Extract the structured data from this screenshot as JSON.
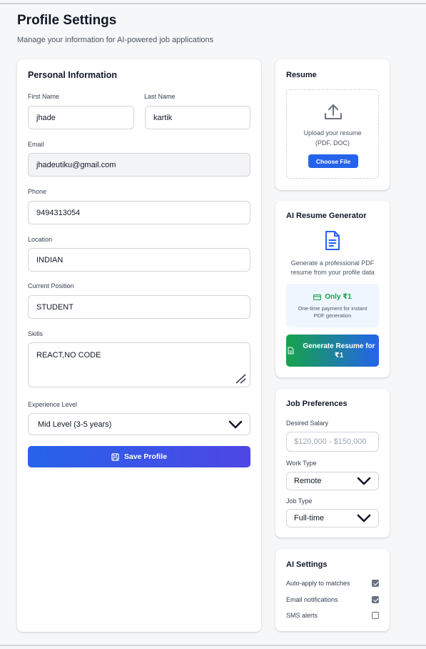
{
  "header": {
    "title": "Profile Settings",
    "subtitle": "Manage your information for AI-powered job applications"
  },
  "personal": {
    "title": "Personal Information",
    "first_name_label": "First Name",
    "first_name_value": "jhade",
    "last_name_label": "Last Name",
    "last_name_value": "kartik",
    "email_label": "Email",
    "email_value": "jhadeutiku@gmail.com",
    "phone_label": "Phone",
    "phone_value": "9494313054",
    "location_label": "Location",
    "location_value": "INDIAN",
    "position_label": "Current Position",
    "position_value": "STUDENT",
    "skills_label": "Skills",
    "skills_value": "REACT,NO CODE",
    "experience_label": "Experience Level",
    "experience_value": "Mid Level (3-5 years)",
    "save_label": "Save Profile"
  },
  "resume": {
    "title": "Resume",
    "upload_line1": "Upload your resume",
    "upload_line2": "(PDF, DOC)",
    "choose_label": "Choose File"
  },
  "generator": {
    "title": "AI Resume Generator",
    "desc_line1": "Generate a professional PDF",
    "desc_line2": "resume from your profile data",
    "price": "Only ₹1",
    "price_sub_line1": "One-time payment for instant",
    "price_sub_line2": "PDF generation",
    "button_line1": "Generate Resume for",
    "button_line2": "₹1"
  },
  "preferences": {
    "title": "Job Preferences",
    "salary_label": "Desired Salary",
    "salary_placeholder": "$120,000 - $150,000",
    "work_type_label": "Work Type",
    "work_type_value": "Remote",
    "job_type_label": "Job Type",
    "job_type_value": "Full-time"
  },
  "ai_settings": {
    "title": "AI Settings",
    "items": [
      {
        "label": "Auto-apply to matches",
        "checked": true
      },
      {
        "label": "Email notifications",
        "checked": true
      },
      {
        "label": "SMS alerts",
        "checked": false
      }
    ]
  },
  "colors": {
    "primary": "#2563eb",
    "accent": "#4f46e5",
    "success": "#16a34a"
  }
}
